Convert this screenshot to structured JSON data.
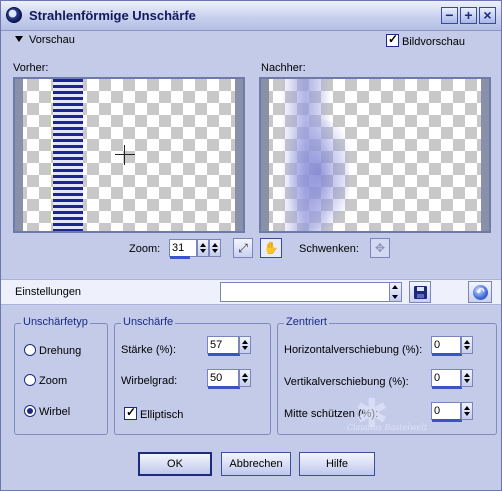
{
  "window": {
    "title": "Strahlenförmige Unschärfe"
  },
  "titlebar_buttons": [
    {
      "name": "minimize",
      "glyph": "−"
    },
    {
      "name": "maximize",
      "glyph": "+"
    },
    {
      "name": "close",
      "glyph": "×"
    }
  ],
  "preview": {
    "toggle_label": "Vorschau",
    "bild_label": "Bildvorschau",
    "bild_checked": true
  },
  "panels": {
    "before_label": "Vorher:",
    "after_label": "Nachher:"
  },
  "zoom": {
    "label": "Zoom:",
    "value": "31",
    "pan_label": "Schwenken:"
  },
  "einstellungen": {
    "label": "Einstellungen",
    "selected": ""
  },
  "blur_type": {
    "legend": "Unschärfetyp",
    "options": [
      "Drehung",
      "Zoom",
      "Wirbel"
    ],
    "selected": "Wirbel"
  },
  "blur": {
    "legend": "Unschärfe",
    "strength_label": "Stärke (%):",
    "strength_value": "57",
    "swirl_label": "Wirbelgrad:",
    "swirl_value": "50",
    "elliptic_label": "Elliptisch",
    "elliptic_checked": true
  },
  "centered": {
    "legend": "Zentriert",
    "h_label": "Horizontalverschiebung (%):",
    "h_value": "0",
    "v_label": "Vertikalverschiebung (%):",
    "v_value": "0",
    "m_label": "Mitte schützen (%):",
    "m_value": "0"
  },
  "watermark": {
    "line1": "Claudias Bastelwelt"
  },
  "buttons": {
    "ok": "OK",
    "cancel": "Abbrechen",
    "help": "Hilfe"
  },
  "colors": {
    "accent": "#1c2b80",
    "window_bg": "#c3cbe8",
    "stripe": "#1c2690"
  }
}
